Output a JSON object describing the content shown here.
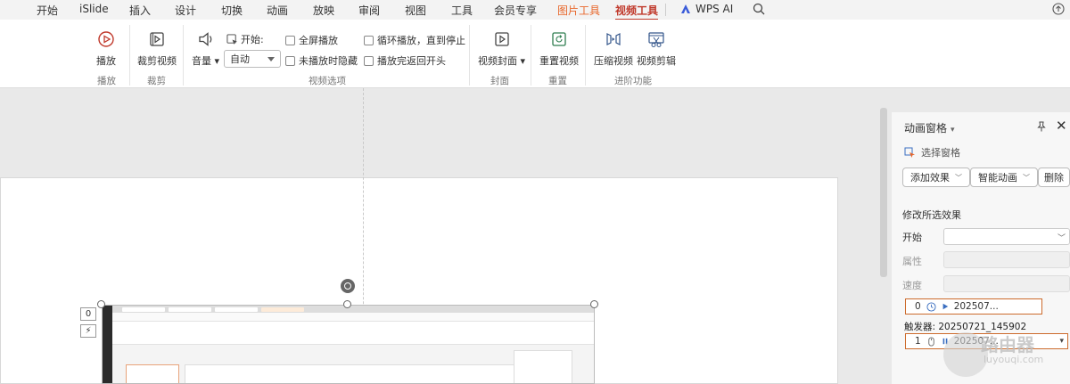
{
  "menu": {
    "tabs": [
      "开始",
      "iSlide",
      "插入",
      "设计",
      "切换",
      "动画",
      "放映",
      "审阅",
      "视图",
      "工具",
      "会员专享"
    ],
    "picture_tools": "图片工具",
    "video_tools": "视频工具",
    "wps_ai": "WPS AI"
  },
  "ribbon": {
    "play": "播放",
    "trim_video": "裁剪视频",
    "volume": "音量",
    "start_label": "开始:",
    "start_value": "自动",
    "fullscreen": "全屏播放",
    "hide_when_not_playing": "未播放时隐藏",
    "loop_until_stopped": "循环播放，直到停止",
    "rewind_after_playing": "播放完返回开头",
    "video_cover": "视频封面",
    "reset_video": "重置视频",
    "compress_video": "压缩视频",
    "video_edit": "视频剪辑",
    "groups": {
      "playback": "播放",
      "trim": "裁剪",
      "video_options": "视频选项",
      "cover": "封面",
      "reset": "重置",
      "advanced": "进阶功能"
    }
  },
  "slide": {
    "tag_zero": "0",
    "tag_bolt": "⚡"
  },
  "pane": {
    "title": "动画窗格",
    "select_pane": "选择窗格",
    "add_effect": "添加效果",
    "smart_animation": "智能动画",
    "delete": "删除",
    "modify_section": "修改所选效果",
    "start_label": "开始",
    "property_label": "属性",
    "speed_label": "速度",
    "item1_index": "0",
    "item1_name": "202507...",
    "trigger_label": "触发器: 20250721_145902",
    "item2_index": "1",
    "item2_name": "202507..."
  },
  "watermark": {
    "text": "路由器",
    "sub": "luyouqi.com"
  },
  "colors": {
    "accent": "#c0392b",
    "picture_tools": "#e8672b",
    "selected_border": "#cc6b2c"
  }
}
